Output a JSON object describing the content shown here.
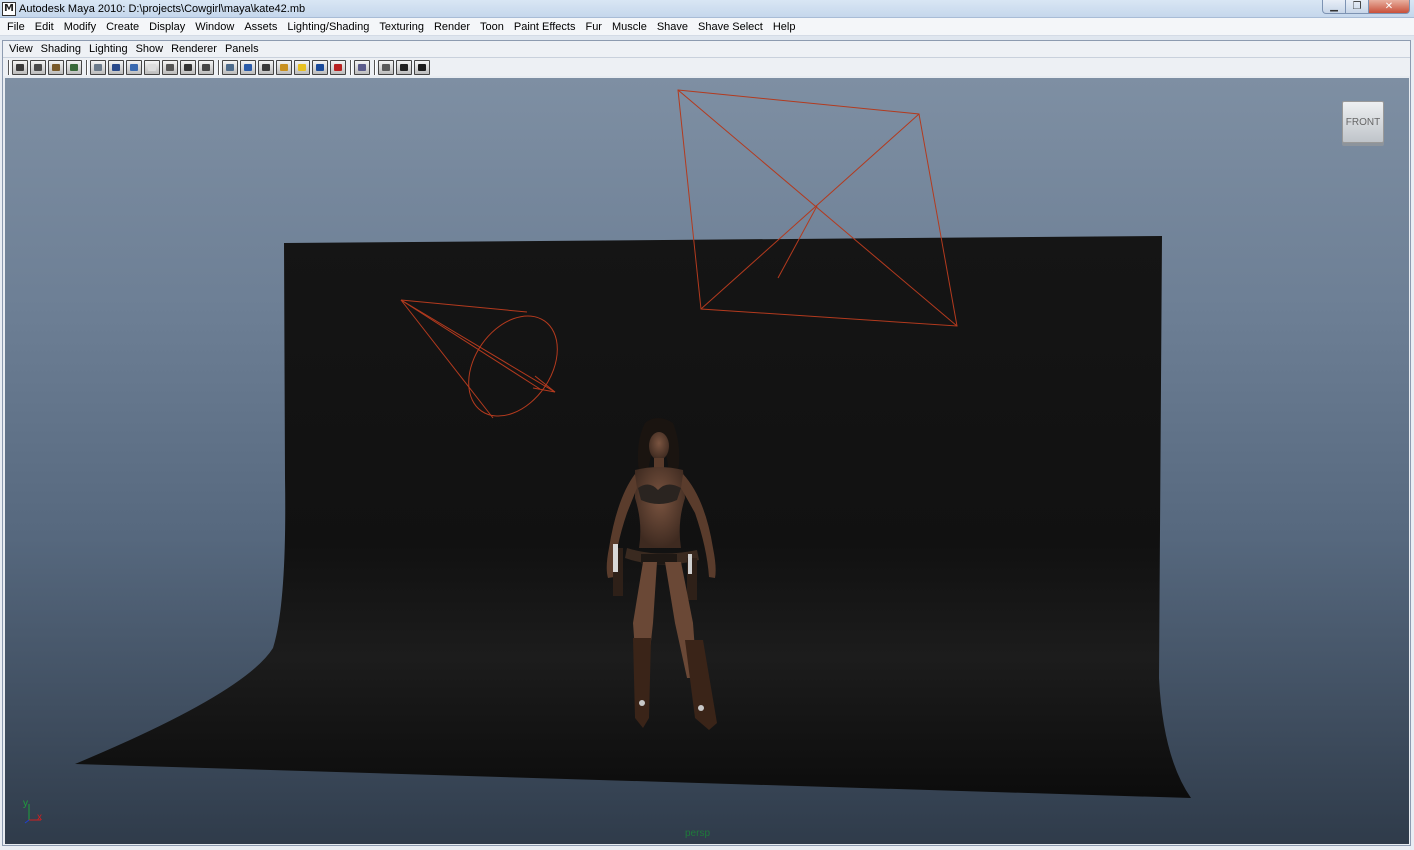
{
  "window": {
    "title": "Autodesk Maya 2010: D:\\projects\\Cowgirl\\maya\\kate42.mb",
    "icon": "maya-app-icon",
    "controls": {
      "minimize": "▁",
      "maximize": "❐",
      "close": "✕"
    }
  },
  "main_menu": [
    "File",
    "Edit",
    "Modify",
    "Create",
    "Display",
    "Window",
    "Assets",
    "Lighting/Shading",
    "Texturing",
    "Render",
    "Toon",
    "Paint Effects",
    "Fur",
    "Muscle",
    "Shave",
    "Shave Select",
    "Help"
  ],
  "panel_menu": [
    "View",
    "Shading",
    "Lighting",
    "Show",
    "Renderer",
    "Panels"
  ],
  "toolbar_icons": [
    {
      "name": "select-camera-icon",
      "color": "#3a3a3a"
    },
    {
      "name": "camera-attributes-icon",
      "color": "#4a4a4a"
    },
    {
      "name": "bookmark-icon",
      "color": "#7a5a2a"
    },
    {
      "name": "image-plane-icon",
      "color": "#3a6a3a"
    },
    {
      "name": "sep"
    },
    {
      "name": "grid-icon",
      "color": "#6b7a8a"
    },
    {
      "name": "film-gate-icon",
      "color": "#2a4a8a"
    },
    {
      "name": "resolution-gate-icon",
      "color": "#3b6ab0"
    },
    {
      "name": "gate-mask-icon",
      "color": "#dddddd"
    },
    {
      "name": "field-chart-icon",
      "color": "#555555"
    },
    {
      "name": "safe-action-icon",
      "color": "#333333"
    },
    {
      "name": "safe-title-icon",
      "color": "#444444"
    },
    {
      "name": "sep"
    },
    {
      "name": "wireframe-icon",
      "color": "#4d6a8a"
    },
    {
      "name": "smooth-shade-icon",
      "color": "#2a5aa8"
    },
    {
      "name": "wireframe-on-shaded-icon",
      "color": "#3a3a3a"
    },
    {
      "name": "textured-icon",
      "color": "#c89020"
    },
    {
      "name": "use-all-lights-icon",
      "color": "#e8c020"
    },
    {
      "name": "shadows-icon",
      "color": "#1a4a9a"
    },
    {
      "name": "hardware-texturing-icon",
      "color": "#b82020"
    },
    {
      "name": "sep"
    },
    {
      "name": "isolate-select-icon",
      "color": "#5a5a8a"
    },
    {
      "name": "sep"
    },
    {
      "name": "xray-icon",
      "color": "#5a5a5a"
    },
    {
      "name": "xray-joints-icon",
      "color": "#222222"
    },
    {
      "name": "high-quality-icon",
      "color": "#1a1a1a"
    }
  ],
  "viewport": {
    "camera": "persp",
    "viewcube_label": "FRONT",
    "axis": {
      "y": "y",
      "x": "x"
    },
    "light_color": "#b33a1e",
    "backdrop_color": "#111111"
  }
}
